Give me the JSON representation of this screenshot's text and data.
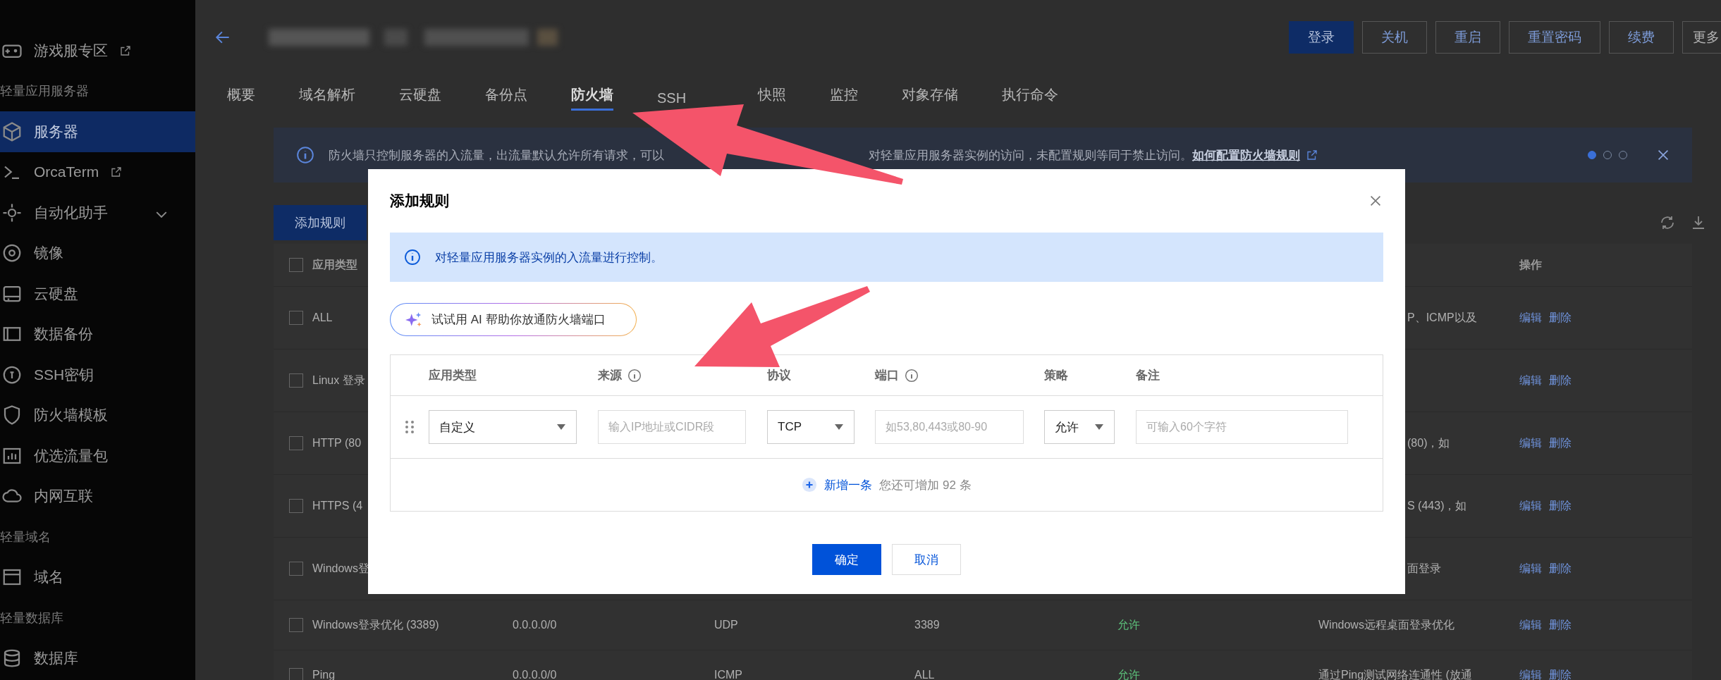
{
  "sidebar": {
    "items": [
      {
        "kind": "external",
        "label": "游戏服专区",
        "selected": false
      },
      {
        "kind": "section",
        "label": "轻量应用服务器",
        "selected": false
      },
      {
        "kind": "item",
        "label": "服务器",
        "selected": true
      },
      {
        "kind": "external",
        "label": "OrcaTerm",
        "selected": false
      },
      {
        "kind": "expandable",
        "label": "自动化助手",
        "selected": false
      },
      {
        "kind": "item",
        "label": "镜像",
        "selected": false
      },
      {
        "kind": "item",
        "label": "云硬盘",
        "selected": false
      },
      {
        "kind": "item",
        "label": "数据备份",
        "selected": false
      },
      {
        "kind": "item",
        "label": "SSH密钥",
        "selected": false
      },
      {
        "kind": "item",
        "label": "防火墙模板",
        "selected": false
      },
      {
        "kind": "item",
        "label": "优选流量包",
        "selected": false
      },
      {
        "kind": "item",
        "label": "内网互联",
        "selected": false
      },
      {
        "kind": "section",
        "label": "轻量域名",
        "selected": false
      },
      {
        "kind": "item",
        "label": "域名",
        "selected": false
      },
      {
        "kind": "section",
        "label": "轻量数据库",
        "selected": false
      },
      {
        "kind": "item",
        "label": "数据库",
        "selected": false
      }
    ]
  },
  "header": {
    "buttons": [
      {
        "label": "登录",
        "kind": "primary"
      },
      {
        "label": "关机",
        "kind": "default"
      },
      {
        "label": "重启",
        "kind": "default"
      },
      {
        "label": "重置密码",
        "kind": "default"
      },
      {
        "label": "续费",
        "kind": "default"
      },
      {
        "label": "更多",
        "kind": "default"
      }
    ]
  },
  "tabs": [
    {
      "label": "概要",
      "selected": false,
      "kind": "full"
    },
    {
      "label": "域名解析",
      "selected": false,
      "kind": "full"
    },
    {
      "label": "云硬盘",
      "selected": false,
      "kind": "full"
    },
    {
      "label": "备份点",
      "selected": false,
      "kind": "full"
    },
    {
      "label": "防火墙",
      "selected": true,
      "kind": "full"
    },
    {
      "label": "SSH",
      "selected": false,
      "kind": "covered"
    },
    {
      "label": "快照",
      "selected": false,
      "kind": "full"
    },
    {
      "label": "监控",
      "selected": false,
      "kind": "full"
    },
    {
      "label": "对象存储",
      "selected": false,
      "kind": "full"
    },
    {
      "label": "执行命令",
      "selected": false,
      "kind": "full"
    }
  ],
  "banner": {
    "text_start": "防火墙只控制服务器的入流量，出流量默认允许所有请求，可以",
    "text_end": "对轻量应用服务器实例的访问，未配置规则等同于禁止访问。",
    "link": "如何配置防火墙规则",
    "pages": [
      {
        "selected": true
      },
      {
        "selected": false
      },
      {
        "selected": false
      }
    ]
  },
  "toolbar": {
    "add_button": "添加规则"
  },
  "table": {
    "header": {
      "checked": false,
      "type": "应用类型",
      "actions": "操作"
    },
    "rows": [
      {
        "kind": "covered",
        "checked": false,
        "type": "ALL",
        "description": "P、ICMP以及",
        "actions": [
          "编辑",
          "删除"
        ]
      },
      {
        "kind": "covered",
        "checked": false,
        "type": "Linux 登录",
        "actions": [
          "编辑",
          "删除"
        ]
      },
      {
        "kind": "covered",
        "checked": false,
        "type": "HTTP (80",
        "description": "(80)，如",
        "actions": [
          "编辑",
          "删除"
        ]
      },
      {
        "kind": "covered",
        "checked": false,
        "type": "HTTPS (4",
        "description": "S (443)，如",
        "actions": [
          "编辑",
          "删除"
        ]
      },
      {
        "kind": "covered",
        "checked": false,
        "type": "Windows登",
        "description": "面登录",
        "actions": [
          "编辑",
          "删除"
        ]
      },
      {
        "kind": "full",
        "checked": false,
        "type": "Windows登录优化 (3389)",
        "source": "0.0.0.0/0",
        "protocol": "UDP",
        "port": "3389",
        "policy": "允许",
        "description": "Windows远程桌面登录优化",
        "actions": [
          "编辑",
          "删除"
        ]
      },
      {
        "kind": "full",
        "checked": false,
        "type": "Ping",
        "source": "0.0.0.0/0",
        "protocol": "ICMP",
        "port": "ALL",
        "policy": "允许",
        "description": "通过Ping测试网络连通性 (放通",
        "actions": [
          "编辑",
          "删除"
        ]
      }
    ]
  },
  "dialog": {
    "title": "添加规则",
    "alert": "对轻量应用服务器实例的入流量进行控制。",
    "ai_button": "试试用 AI 帮助你放通防火墙端口",
    "columns": [
      {
        "label": "应用类型",
        "kind": "plain"
      },
      {
        "label": "来源",
        "kind": "info"
      },
      {
        "label": "协议",
        "kind": "plain"
      },
      {
        "label": "端口",
        "kind": "info"
      },
      {
        "label": "策略",
        "kind": "plain"
      },
      {
        "label": "备注",
        "kind": "plain"
      }
    ],
    "fields": [
      {
        "kind": "select",
        "value": "自定义"
      },
      {
        "kind": "input",
        "placeholder": "输入IP地址或CIDR段"
      },
      {
        "kind": "select",
        "value": "TCP"
      },
      {
        "kind": "input",
        "placeholder": "如53,80,443或80-90"
      },
      {
        "kind": "select",
        "value": "允许"
      },
      {
        "kind": "input",
        "placeholder": "可输入60个字符"
      }
    ],
    "add_link": "新增一条",
    "remaining": "您还可增加 92 条",
    "buttons": [
      {
        "label": "确定",
        "kind": "primary"
      },
      {
        "label": "取消",
        "kind": "default"
      }
    ]
  }
}
